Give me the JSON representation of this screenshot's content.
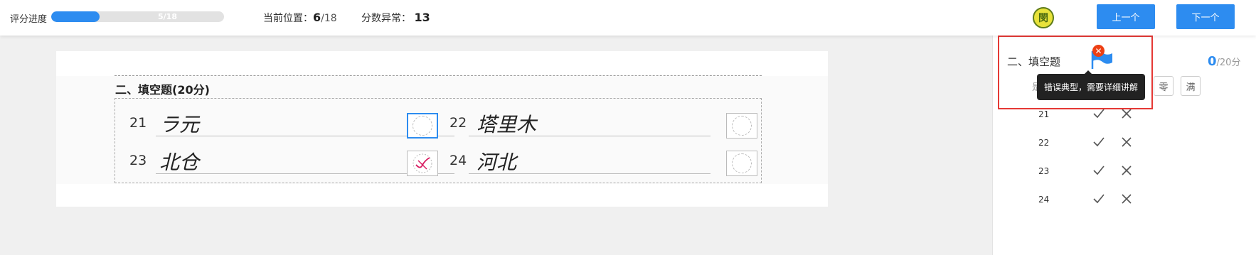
{
  "topbar": {
    "progress_label": "评分进度",
    "progress_text": "5/18",
    "progress_fraction": 0.2778,
    "position_label": "当前位置：",
    "position_current": "6",
    "position_total": "/18",
    "anomaly_label": "分数异常：",
    "anomaly_count": "13",
    "avatar_glyph": "閔",
    "prev_label": "上一个",
    "next_label": "下一个"
  },
  "sheet": {
    "section_title": "二、填空题(20分)",
    "questions": [
      {
        "num": "21",
        "answer": "ラ元"
      },
      {
        "num": "22",
        "answer": "塔里木"
      },
      {
        "num": "23",
        "answer": "北仓"
      },
      {
        "num": "24",
        "answer": "河北"
      }
    ]
  },
  "panel": {
    "section_title": "二、填空题",
    "score_got": "0",
    "score_total": "/20分",
    "tooltip": "错误典型，需要详细讲解",
    "partial_label": "是",
    "quick_zero": "零",
    "quick_full": "满",
    "rows": [
      {
        "num": "21"
      },
      {
        "num": "22"
      },
      {
        "num": "23"
      },
      {
        "num": "24"
      }
    ],
    "flag_color": "#2d8cf0",
    "close_color": "#ed4014"
  },
  "colors": {
    "accent": "#2d8cf0",
    "highlight": "#e53935"
  }
}
